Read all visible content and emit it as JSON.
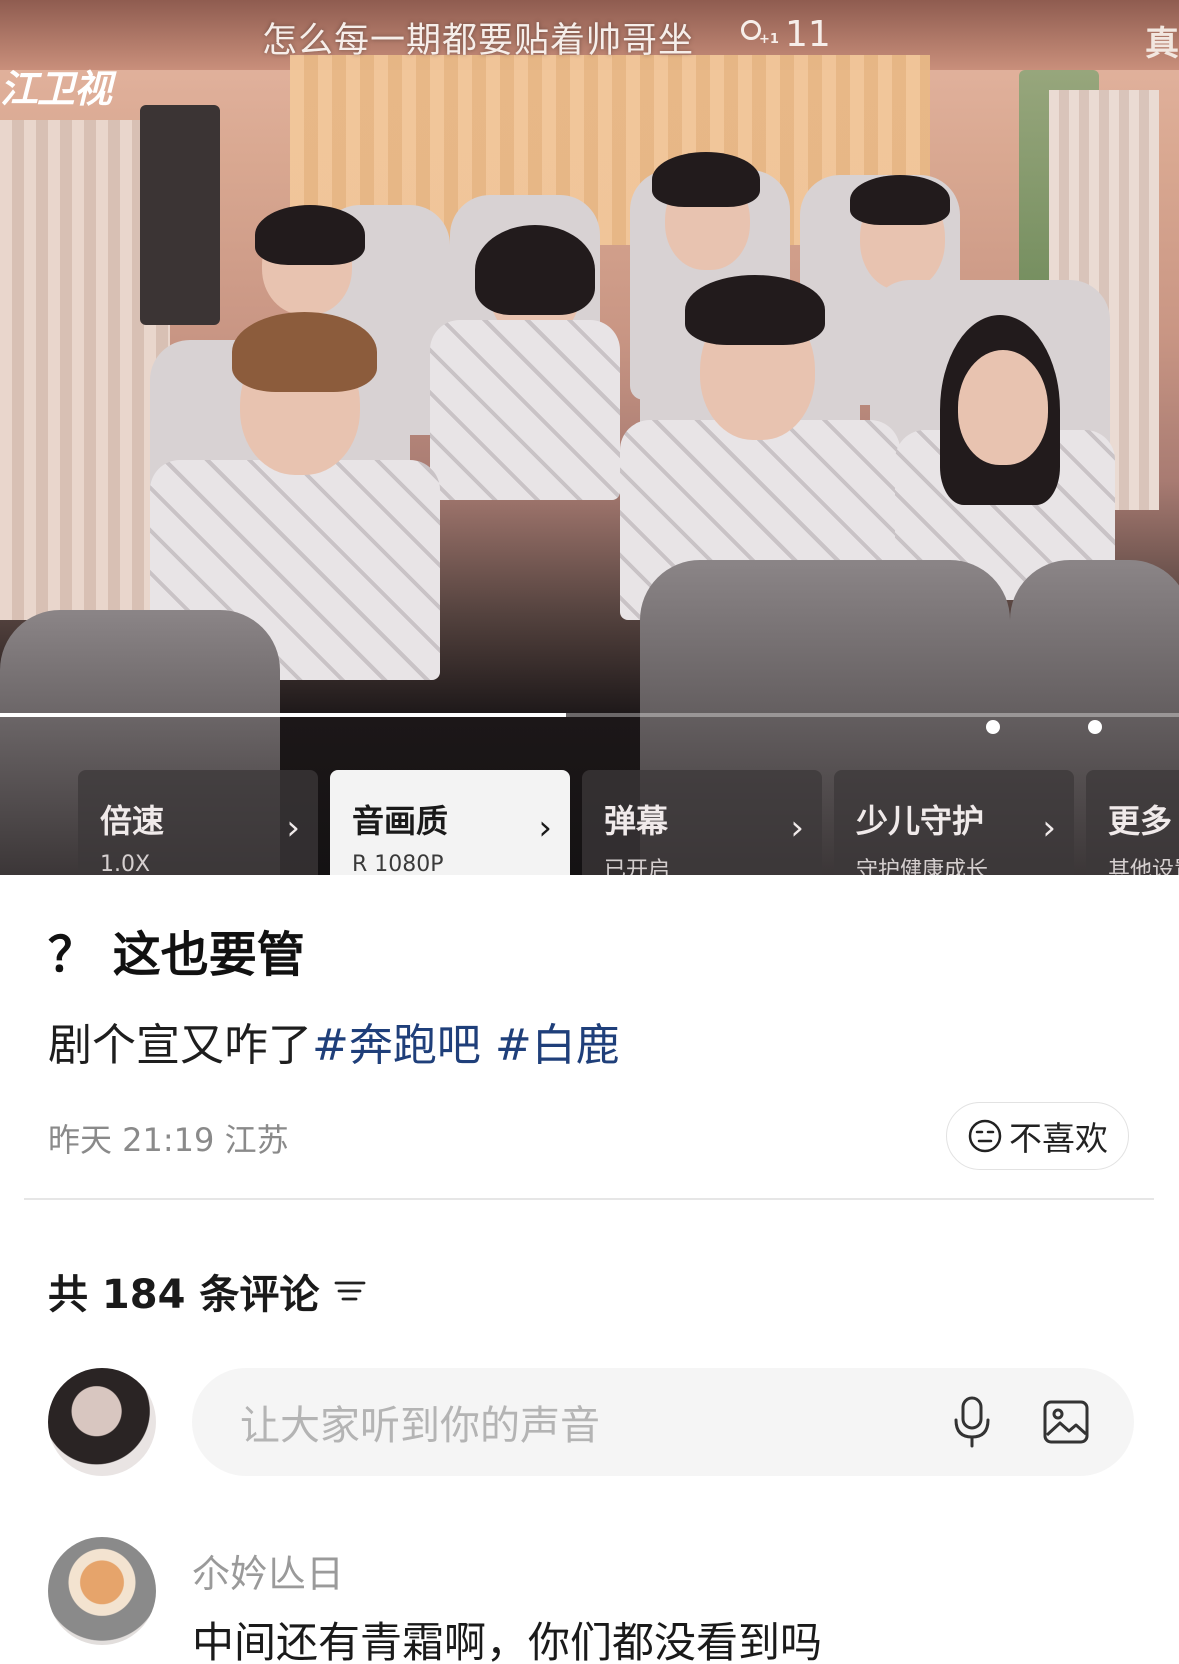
{
  "video": {
    "title": "怎么每一期都要贴着帅哥坐",
    "viewer_count": "11",
    "channel_logo": "江卫视",
    "corner_text": "真",
    "progress": 0.48,
    "settings": [
      {
        "label": "倍速",
        "sub": "1.0X"
      },
      {
        "label": "音画质",
        "sub": "R 1080P"
      },
      {
        "label": "弹幕",
        "sub": "已开启"
      },
      {
        "label": "少儿守护",
        "sub": "守护健康成长"
      },
      {
        "label": "更多",
        "sub": "其他设置"
      }
    ]
  },
  "post": {
    "title": "？ 这也要管",
    "body_text": "剧个宣又咋了",
    "tags": [
      "#奔跑吧",
      " #白鹿"
    ],
    "time": "昨天 21:19",
    "location": "江苏",
    "dislike_label": "不喜欢"
  },
  "comments": {
    "count_label": "共 184 条评论",
    "input_placeholder": "让大家听到你的声音",
    "items": [
      {
        "user": "尒妗亾日",
        "text": "中间还有青霜啊，你们都没看到吗"
      }
    ]
  },
  "icons": {
    "dislike": "neutral-face-icon",
    "sort": "sort-lines-icon",
    "mic": "microphone-icon",
    "image": "image-icon",
    "viewer": "user-plus-icon"
  },
  "colors": {
    "tag": "#1f3f7a",
    "meta": "#8a8a8a",
    "input_bg": "#f5f5f5"
  }
}
